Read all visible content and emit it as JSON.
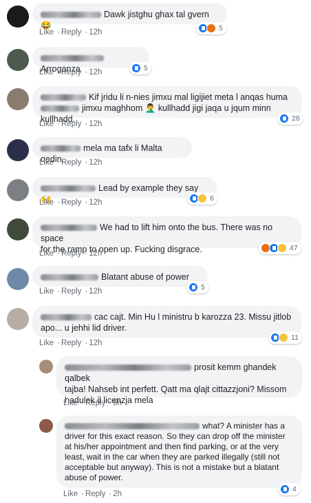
{
  "colors": {
    "bubble_bg": "#f2f3f5",
    "link": "#606770",
    "reaction_like": "#1877f2"
  },
  "comments": [
    {
      "text": "Dawk jistghu ghax tal gvern 😂",
      "like": "Like",
      "reply": "Reply",
      "time": "12h",
      "count": "5",
      "reactions": [
        "like",
        "angry"
      ]
    },
    {
      "text": "Arroganza",
      "like": "Like",
      "reply": "Reply",
      "time": "12h",
      "count": "5",
      "reactions": [
        "like"
      ]
    },
    {
      "text": "Kif jridu li n-nies jimxu mal ligijiet meta l anqas huma",
      "text2": "jimxu maghhom 🤦‍♂️ kullhadd jigi jaqa u jqum minn kullhadd.",
      "like": "Like",
      "reply": "Reply",
      "time": "12h",
      "count": "28",
      "reactions": [
        "like"
      ]
    },
    {
      "text": "mela ma tafx li Malta qedin.",
      "like": "Like",
      "reply": "Reply",
      "time": "12h",
      "count": "",
      "reactions": []
    },
    {
      "text": "Lead by example they say 🙌",
      "like": "Like",
      "reply": "Reply",
      "time": "12h",
      "count": "6",
      "reactions": [
        "like",
        "sad"
      ]
    },
    {
      "text": "We had to lift him onto the bus. There was no space",
      "text2": "for the ramp to open up. Fucking disgrace.",
      "like": "Like",
      "reply": "Reply",
      "time": "12h",
      "count": "47",
      "reactions": [
        "angry",
        "like",
        "sad"
      ]
    },
    {
      "text": "Blatant abuse of power",
      "like": "Like",
      "reply": "Reply",
      "time": "12h",
      "count": "5",
      "reactions": [
        "like"
      ]
    },
    {
      "text": "cac cajt. Min Hu l ministru b karozza 23. Missu jitlob",
      "text2": "apo... u jehhi lid driver.",
      "like": "Like",
      "reply": "Reply",
      "time": "12h",
      "count": "11",
      "reactions": [
        "like",
        "haha"
      ]
    },
    {
      "text": "prosit kemm ghandek qalbek",
      "text2": "tajba! Nahseb int perfett. Qatt ma qlajt cittazzjoni? Missom",
      "text3": "hadulek il licenzja mela",
      "like": "Like",
      "reply": "Reply",
      "time": "5h",
      "count": "",
      "reactions": []
    },
    {
      "text": "what? A minister has a",
      "text2": "driver for this exact reason. So they can drop off the minister",
      "text3": "at his/her appointment and then find parking, or at the very",
      "text4": "least, wait in the car when they are parked illegally (still not",
      "text5": "acceptable but anyway). This is not a mistake but a blatant",
      "text6": "abuse of power.",
      "like": "Like",
      "reply": "Reply",
      "time": "2h",
      "count": "4",
      "reactions": [
        "like"
      ]
    }
  ]
}
